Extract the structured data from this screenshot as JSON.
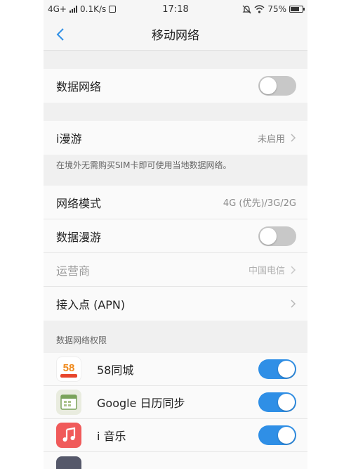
{
  "status_bar": {
    "network": "4G+",
    "speed": "0.1K/s",
    "time": "17:18",
    "battery": "75%",
    "battery_level": 0.75
  },
  "nav": {
    "title": "移动网络"
  },
  "data_network": {
    "label": "数据网络",
    "enabled": false
  },
  "roaming": {
    "label": "i漫游",
    "value": "未启用",
    "hint": "在境外无需购买SIM卡即可使用当地数据网络。"
  },
  "settings": {
    "network_mode": {
      "label": "网络模式",
      "value": "4G (优先)/3G/2G"
    },
    "data_roaming": {
      "label": "数据漫游",
      "enabled": false
    },
    "carrier": {
      "label": "运营商",
      "value": "中国电信"
    },
    "apn": {
      "label": "接入点 (APN)"
    }
  },
  "permissions": {
    "header": "数据网络权限",
    "apps": [
      {
        "name": "58同城",
        "icon": "58-tongcheng-icon",
        "enabled": true,
        "icon_text": "58"
      },
      {
        "name": "Google 日历同步",
        "icon": "calendar-sync-icon",
        "enabled": true
      },
      {
        "name": "i 音乐",
        "icon": "music-note-icon",
        "enabled": true
      }
    ]
  },
  "colors": {
    "accent": "#2f8fe6",
    "toggle_off": "#c8c8c8",
    "music_icon": "#f05a5a"
  }
}
